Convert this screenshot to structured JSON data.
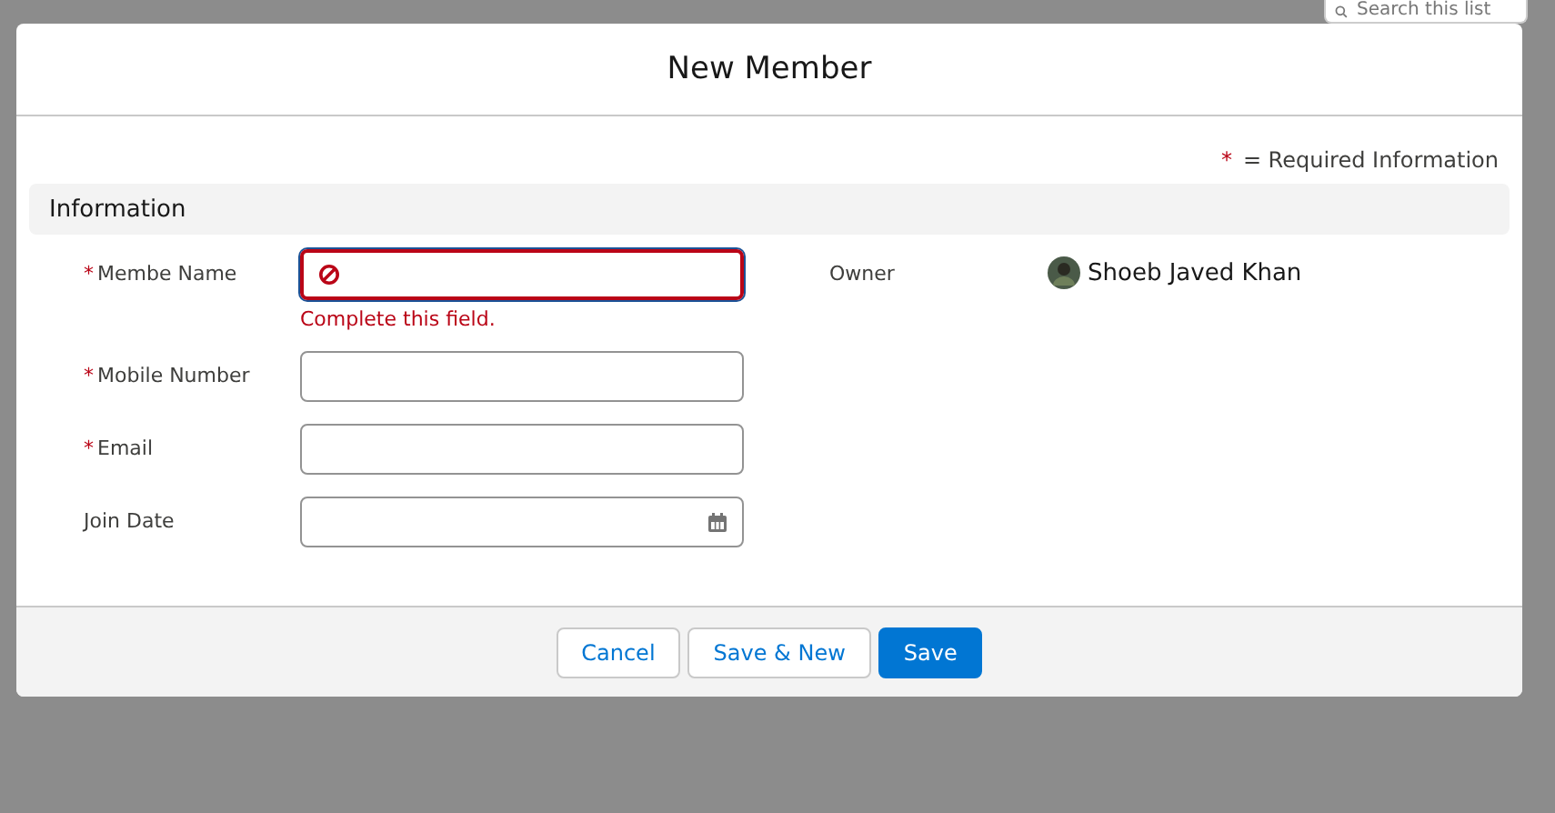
{
  "background": {
    "search": {
      "placeholder": "Search this list"
    }
  },
  "modal": {
    "title": "New Member",
    "required_legend": {
      "mark": "*",
      "text": "= Required Information"
    },
    "section": {
      "title": "Information"
    },
    "fields": [
      {
        "label": "Membe Name",
        "required": true,
        "kind": "text",
        "invalid": true,
        "error": "Complete this field."
      },
      {
        "label": "Mobile Number",
        "required": true,
        "kind": "text",
        "invalid": false
      },
      {
        "label": "Email",
        "required": true,
        "kind": "text",
        "invalid": false
      },
      {
        "label": "Join Date",
        "required": false,
        "kind": "date",
        "invalid": false
      }
    ],
    "owner": {
      "label": "Owner",
      "value": "Shoeb Javed Khan"
    },
    "buttons": [
      {
        "label": "Cancel",
        "kind": "neutral"
      },
      {
        "label": "Save & New",
        "kind": "neutral"
      },
      {
        "label": "Save",
        "kind": "brand"
      }
    ]
  }
}
